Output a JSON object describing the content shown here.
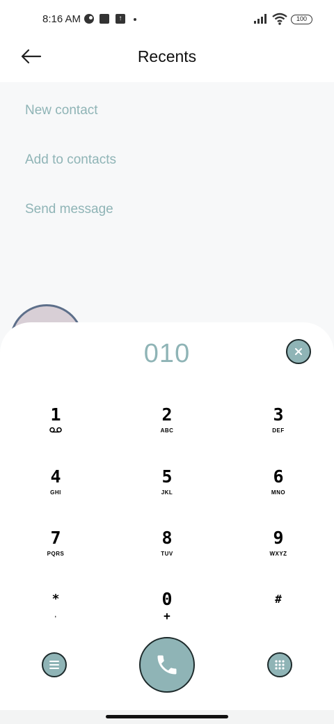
{
  "status_bar": {
    "time": "8:16 AM",
    "battery": "100",
    "icons": [
      "notification-icon",
      "square-icon",
      "upload-icon",
      "signal-icon",
      "wifi-icon",
      "battery-icon"
    ]
  },
  "header": {
    "title": "Recents",
    "back_icon": "arrow-left-icon"
  },
  "actions": [
    {
      "label": "New contact"
    },
    {
      "label": "Add to contacts"
    },
    {
      "label": "Send message"
    }
  ],
  "dialpad": {
    "number": "010",
    "keys": [
      {
        "digit": "1",
        "letters": "",
        "sub_icon": "voicemail-icon"
      },
      {
        "digit": "2",
        "letters": "ABC"
      },
      {
        "digit": "3",
        "letters": "DEF"
      },
      {
        "digit": "4",
        "letters": "GHI"
      },
      {
        "digit": "5",
        "letters": "JKL"
      },
      {
        "digit": "6",
        "letters": "MNO"
      },
      {
        "digit": "7",
        "letters": "PQRS"
      },
      {
        "digit": "8",
        "letters": "TUV"
      },
      {
        "digit": "9",
        "letters": "WXYZ"
      },
      {
        "digit": "*",
        "letters": ","
      },
      {
        "digit": "0",
        "letters": "+"
      },
      {
        "digit": "#",
        "letters": ""
      }
    ]
  },
  "colors": {
    "accent": "#8fb4b6",
    "button_border": "#1d2a2b",
    "background": "#f7f8f9"
  }
}
